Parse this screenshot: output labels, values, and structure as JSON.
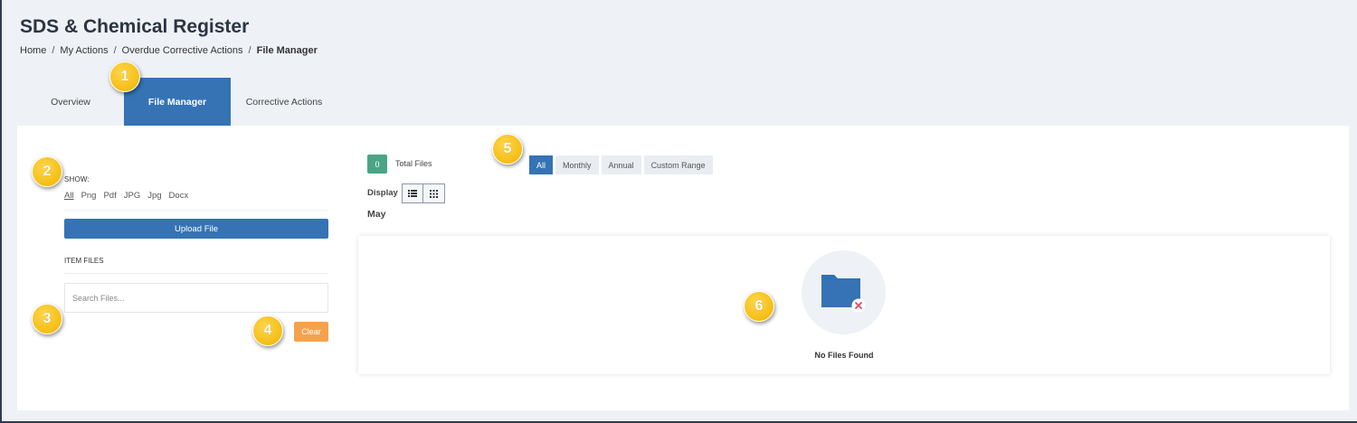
{
  "header": {
    "title": "SDS & Chemical Register",
    "breadcrumb": [
      "Home",
      "My Actions",
      "Overdue Corrective Actions",
      "File Manager"
    ]
  },
  "tabs": [
    "Overview",
    "File Manager",
    "Corrective Actions"
  ],
  "active_tab": "File Manager",
  "sidebar": {
    "show_label": "SHOW:",
    "filters": [
      "All",
      "Png",
      "Pdf",
      "JPG",
      "Jpg",
      "Docx"
    ],
    "active_filter": "All",
    "upload_label": "Upload File",
    "item_files_label": "ITEM FILES",
    "search_placeholder": "Search Files...",
    "clear_label": "Clear"
  },
  "main": {
    "total_count": "0",
    "total_label": "Total Files",
    "display_label": "Display",
    "month_label": "May",
    "range_tabs": [
      "All",
      "Monthly",
      "Annual",
      "Custom Range"
    ],
    "active_range": "All",
    "empty_text": "No Files Found"
  },
  "callouts": [
    "1",
    "2",
    "3",
    "4",
    "5",
    "6"
  ],
  "colors": {
    "primary": "#3573b5",
    "success": "#4aa586",
    "warning": "#f5a24d",
    "callout": "#f0b400",
    "empty_icon_x": "#e0456b"
  }
}
